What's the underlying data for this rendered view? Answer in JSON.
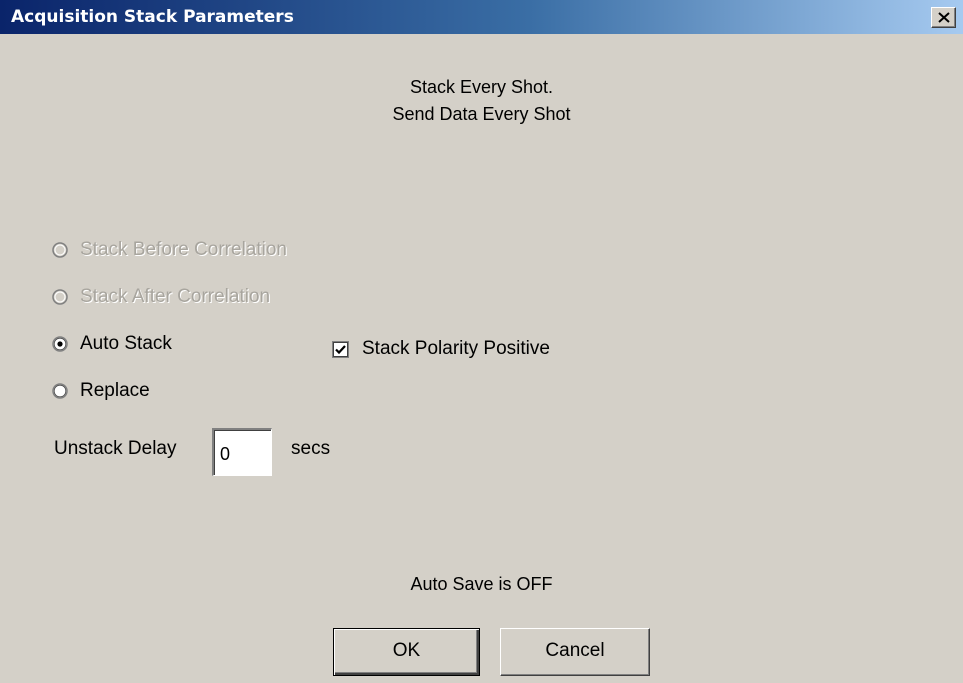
{
  "window": {
    "title": "Acquisition Stack Parameters"
  },
  "info": {
    "line1": "Stack Every Shot.",
    "line2": "Send Data Every Shot"
  },
  "stack_mode": {
    "options": [
      {
        "label": "Stack Before Correlation",
        "enabled": false,
        "selected": false
      },
      {
        "label": "Stack After Correlation",
        "enabled": false,
        "selected": false
      },
      {
        "label": "Auto Stack",
        "enabled": true,
        "selected": true
      },
      {
        "label": "Replace",
        "enabled": true,
        "selected": false
      }
    ]
  },
  "polarity": {
    "label": "Stack Polarity Positive",
    "checked": true
  },
  "unstack_delay": {
    "label": "Unstack Delay",
    "value": "0",
    "unit": "secs"
  },
  "status": {
    "auto_save": "Auto Save is OFF"
  },
  "buttons": {
    "ok_label": "OK",
    "cancel_label": "Cancel"
  },
  "colors": {
    "dialog_face": "#d4d0c8",
    "title_start": "#0a246a",
    "title_end": "#a6caf0",
    "disabled_text": "#a8a59e"
  }
}
